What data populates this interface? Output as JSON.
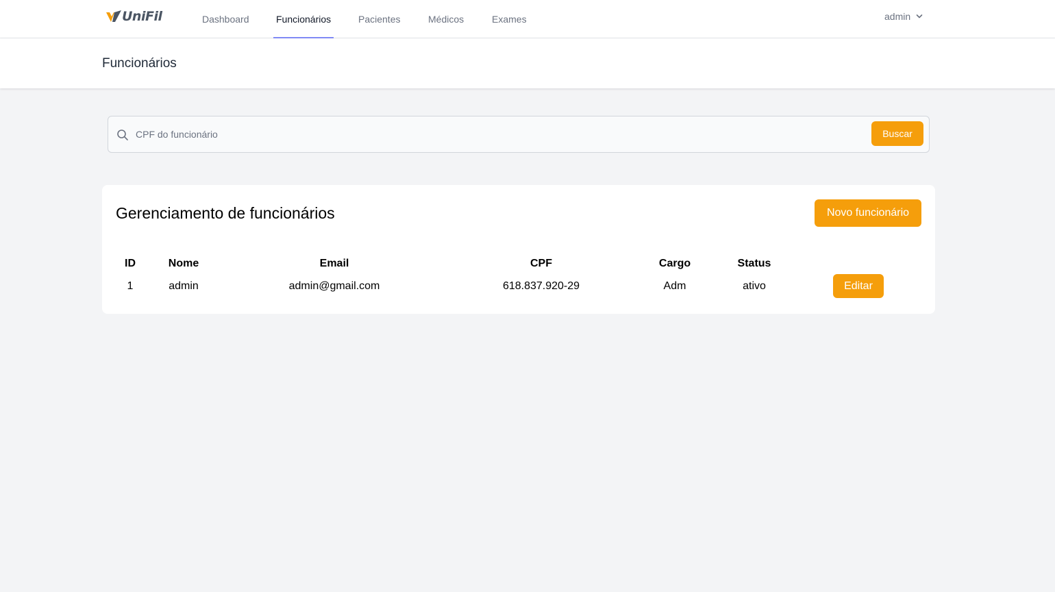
{
  "brand": {
    "logo_text": "UniFil",
    "accent_color": "#f59e0b",
    "nav_active_color": "#818cf8"
  },
  "nav": {
    "items": [
      {
        "label": "Dashboard",
        "active": false
      },
      {
        "label": "Funcionários",
        "active": true
      },
      {
        "label": "Pacientes",
        "active": false
      },
      {
        "label": "Médicos",
        "active": false
      },
      {
        "label": "Exames",
        "active": false
      }
    ],
    "user": {
      "name": "admin",
      "icon": "chevron-down-icon"
    }
  },
  "header": {
    "title": "Funcionários"
  },
  "search": {
    "icon": "search-icon",
    "placeholder": "CPF do funcionário",
    "value": "",
    "button_label": "Buscar"
  },
  "card": {
    "title": "Gerenciamento de funcionários",
    "new_button_label": "Novo funcionário",
    "table": {
      "columns": [
        "ID",
        "Nome",
        "Email",
        "CPF",
        "Cargo",
        "Status"
      ],
      "rows": [
        {
          "id": "1",
          "nome": "admin",
          "email": "admin@gmail.com",
          "cpf": "618.837.920-29",
          "cargo": "Adm",
          "status": "ativo",
          "action_label": "Editar"
        }
      ]
    }
  }
}
